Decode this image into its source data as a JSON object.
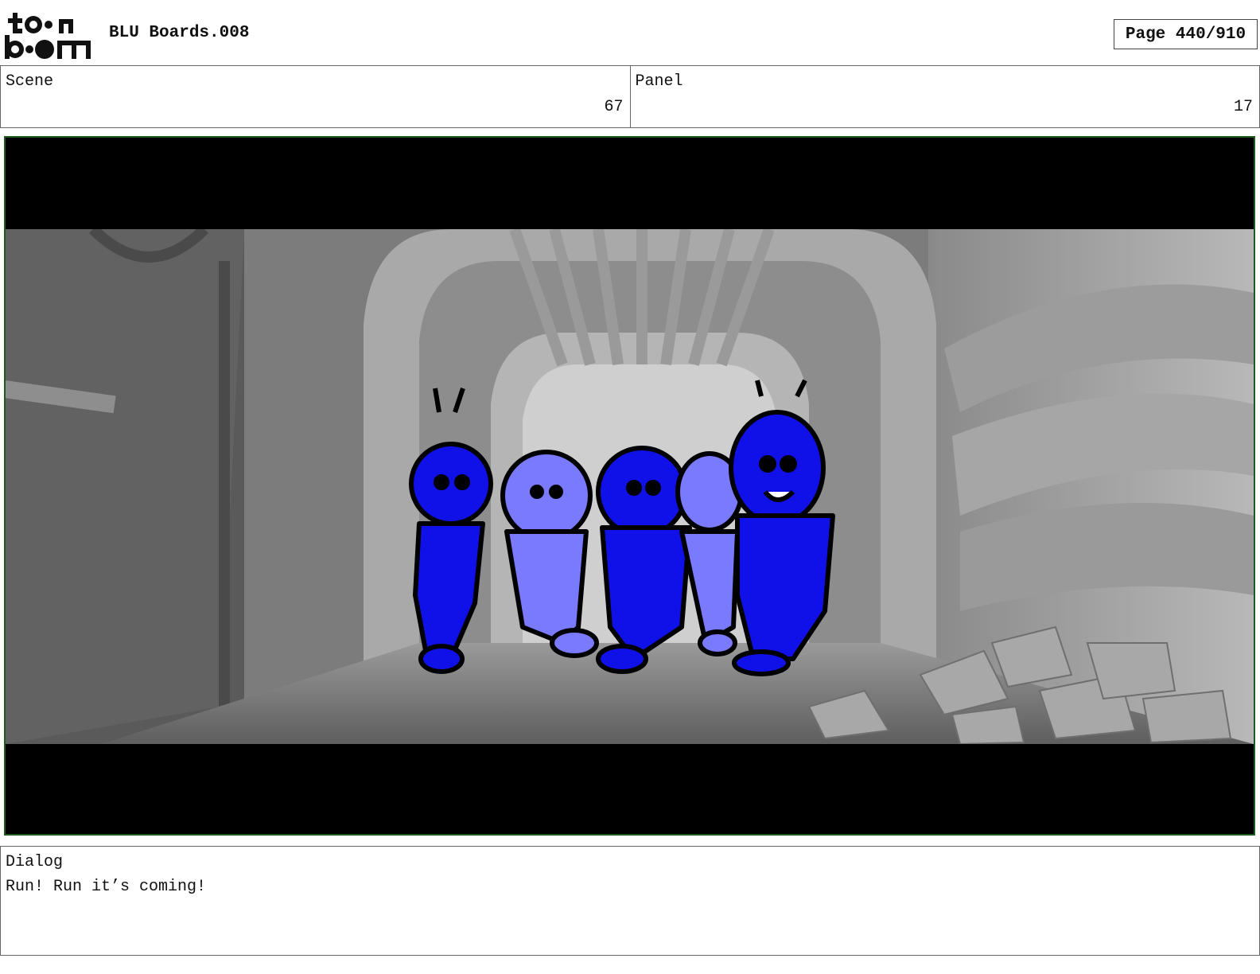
{
  "header": {
    "logo_text": "toon boom",
    "project_title": "BLU Boards.008",
    "page_indicator": "Page 440/910"
  },
  "scene": {
    "label": "Scene",
    "value": "67"
  },
  "panel": {
    "label": "Panel",
    "value": "17"
  },
  "dialog": {
    "label": "Dialog",
    "text": "Run! Run it’s coming!"
  },
  "colors": {
    "character_blue": "#1010e8",
    "character_light_blue": "#7a7aff",
    "frame_border": "#1f5a1f",
    "letterbox": "#000000"
  }
}
